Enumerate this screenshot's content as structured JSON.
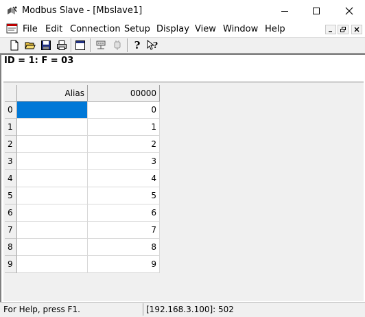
{
  "window": {
    "title": "Modbus Slave - [Mbslave1]"
  },
  "menu": [
    "File",
    "Edit",
    "Connection",
    "Setup",
    "Display",
    "View",
    "Window",
    "Help"
  ],
  "toolbar_icons": [
    "new-file-icon",
    "open-folder-icon",
    "save-icon",
    "print-icon",
    "window-icon",
    "connect-icon",
    "disconnect-icon",
    "help-icon",
    "context-help-icon"
  ],
  "document": {
    "status_line": "ID = 1: F = 03"
  },
  "grid": {
    "headers": [
      "Alias",
      "00000"
    ],
    "rows": [
      {
        "index": "0",
        "alias": "",
        "value": "0"
      },
      {
        "index": "1",
        "alias": "",
        "value": "1"
      },
      {
        "index": "2",
        "alias": "",
        "value": "2"
      },
      {
        "index": "3",
        "alias": "",
        "value": "3"
      },
      {
        "index": "4",
        "alias": "",
        "value": "4"
      },
      {
        "index": "5",
        "alias": "",
        "value": "5"
      },
      {
        "index": "6",
        "alias": "",
        "value": "6"
      },
      {
        "index": "7",
        "alias": "",
        "value": "7"
      },
      {
        "index": "8",
        "alias": "",
        "value": "8"
      },
      {
        "index": "9",
        "alias": "",
        "value": "9"
      }
    ]
  },
  "statusbar": {
    "help": "For Help, press F1.",
    "connection": "[192.168.3.100]: 502"
  },
  "colors": {
    "selection": "#0078d7",
    "toolbar_bg": "#f0f0f0"
  }
}
